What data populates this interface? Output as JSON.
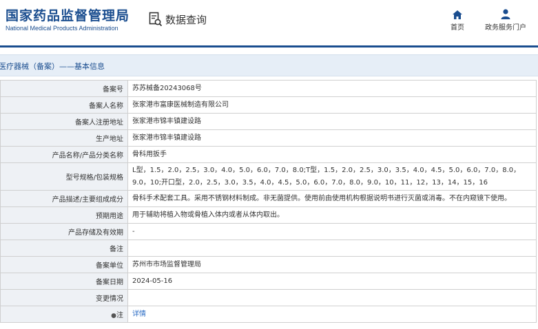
{
  "header": {
    "logo_cn": "国家药品监督管理局",
    "logo_en": "National Medical Products Administration",
    "search_title": "数据查询",
    "nav": [
      {
        "label": "首页",
        "icon": "home-icon"
      },
      {
        "label": "政务服务门户",
        "icon": "user-icon"
      }
    ]
  },
  "colors": {
    "brand": "#1a4d8f",
    "band": "#e6eef7",
    "link": "#2b6cc4"
  },
  "breadcrumb": "医疗器械（备案）——基本信息",
  "detail": {
    "rows": [
      {
        "label": "备案号",
        "value": "苏苏械备20243068号"
      },
      {
        "label": "备案人名称",
        "value": "张家港市富康医械制造有限公司"
      },
      {
        "label": "备案人注册地址",
        "value": "张家港市锦丰镇建设路"
      },
      {
        "label": "生产地址",
        "value": "张家港市锦丰镇建设路"
      },
      {
        "label": "产品名称/产品分类名称",
        "value": "骨科用扳手"
      },
      {
        "label": "型号规格/包装规格",
        "value": "L型，1.5，2.0，2.5，3.0，4.0，5.0，6.0，7.0，8.0;T型，1.5，2.0，2.5，3.0，3.5，4.0，4.5，5.0，6.0，7.0，8.0，9.0，10;开口型，2.0，2.5，3.0，3.5，4.0，4.5，5.0，6.0，7.0，8.0，9.0，10，11，12，13，14，15，16"
      },
      {
        "label": "产品描述/主要组成成分",
        "value": "骨科手术配套工具。采用不锈钢材料制成。非无菌提供。使用前由使用机构根据说明书进行灭菌或消毒。不在内窥镜下使用。"
      },
      {
        "label": "预期用途",
        "value": "用于辅助将植入物或骨植入体内或者从体内取出。"
      },
      {
        "label": "产品存储及有效期",
        "value": "-"
      },
      {
        "label": "备注",
        "value": ""
      },
      {
        "label": "备案单位",
        "value": "苏州市市场监督管理局"
      },
      {
        "label": "备案日期",
        "value": "2024-05-16"
      },
      {
        "label": "变更情况",
        "value": ""
      },
      {
        "label": "注",
        "value": "详情",
        "pin": "●"
      }
    ]
  }
}
